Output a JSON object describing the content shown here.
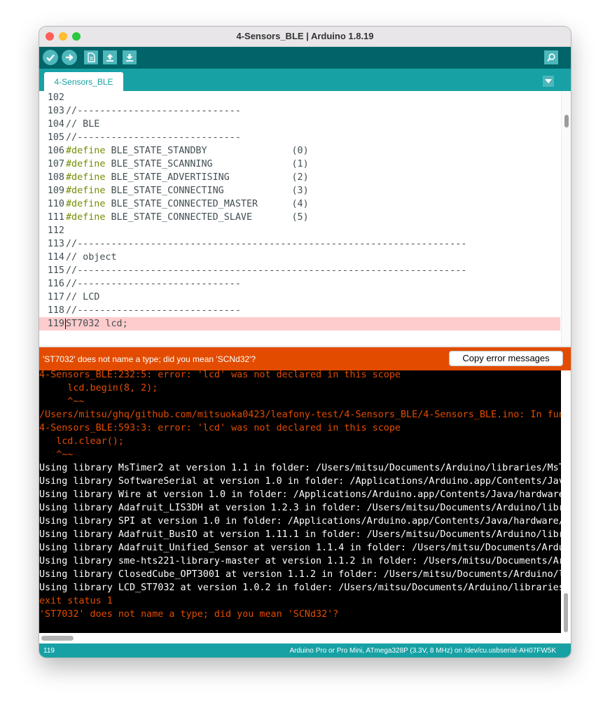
{
  "window": {
    "title": "4-Sensors_BLE | Arduino 1.8.19"
  },
  "toolbar": {
    "buttons": [
      "verify-icon",
      "upload-icon",
      "new-icon",
      "open-icon",
      "save-icon"
    ],
    "serial_monitor": "magnifier-icon"
  },
  "tabs": [
    {
      "label": "4-Sensors_BLE"
    }
  ],
  "editor": {
    "lines": [
      {
        "num": "102",
        "kw": "",
        "text": ""
      },
      {
        "num": "103",
        "kw": "",
        "text": "//-----------------------------"
      },
      {
        "num": "104",
        "kw": "",
        "text": "// BLE"
      },
      {
        "num": "105",
        "kw": "",
        "text": "//-----------------------------"
      },
      {
        "num": "106",
        "kw": "#define",
        "text": " BLE_STATE_STANDBY               (0)"
      },
      {
        "num": "107",
        "kw": "#define",
        "text": " BLE_STATE_SCANNING              (1)"
      },
      {
        "num": "108",
        "kw": "#define",
        "text": " BLE_STATE_ADVERTISING           (2)"
      },
      {
        "num": "109",
        "kw": "#define",
        "text": " BLE_STATE_CONNECTING            (3)"
      },
      {
        "num": "110",
        "kw": "#define",
        "text": " BLE_STATE_CONNECTED_MASTER      (4)"
      },
      {
        "num": "111",
        "kw": "#define",
        "text": " BLE_STATE_CONNECTED_SLAVE       (5)"
      },
      {
        "num": "112",
        "kw": "",
        "text": ""
      },
      {
        "num": "113",
        "kw": "",
        "text": "//---------------------------------------------------------------------"
      },
      {
        "num": "114",
        "kw": "",
        "text": "// object"
      },
      {
        "num": "115",
        "kw": "",
        "text": "//---------------------------------------------------------------------"
      },
      {
        "num": "116",
        "kw": "",
        "text": "//-----------------------------"
      },
      {
        "num": "117",
        "kw": "",
        "text": "// LCD"
      },
      {
        "num": "118",
        "kw": "",
        "text": "//-----------------------------"
      },
      {
        "num": "119",
        "kw": "",
        "text": "ST7032 lcd;",
        "error": true
      }
    ]
  },
  "error_bar": {
    "message": "'ST7032' does not name a type; did you mean 'SCNd32'?",
    "copy_button": "Copy error messages"
  },
  "console": {
    "lines": [
      {
        "text": "4-Sensors_BLE:232:5: error: 'lcd' was not declared in this scope",
        "red": true
      },
      {
        "text": "     lcd.begin(8, 2);",
        "red": true
      },
      {
        "text": "     ^~~",
        "red": true
      },
      {
        "text": "/Users/mitsu/ghq/github.com/mitsuoka0423/leafony-test/4-Sensors_BLE/4-Sensors_BLE.ino: In fun",
        "red": true
      },
      {
        "text": "4-Sensors_BLE:593:3: error: 'lcd' was not declared in this scope",
        "red": true
      },
      {
        "text": "   lcd.clear();",
        "red": true
      },
      {
        "text": "   ^~~",
        "red": true
      },
      {
        "text": "Using library MsTimer2 at version 1.1 in folder: /Users/mitsu/Documents/Arduino/libraries/MsT",
        "red": false
      },
      {
        "text": "Using library SoftwareSerial at version 1.0 in folder: /Applications/Arduino.app/Contents/Jav",
        "red": false
      },
      {
        "text": "Using library Wire at version 1.0 in folder: /Applications/Arduino.app/Contents/Java/hardware",
        "red": false
      },
      {
        "text": "Using library Adafruit_LIS3DH at version 1.2.3 in folder: /Users/mitsu/Documents/Arduino/libr",
        "red": false
      },
      {
        "text": "Using library SPI at version 1.0 in folder: /Applications/Arduino.app/Contents/Java/hardware/",
        "red": false
      },
      {
        "text": "Using library Adafruit_BusIO at version 1.11.1 in folder: /Users/mitsu/Documents/Arduino/libr",
        "red": false
      },
      {
        "text": "Using library Adafruit_Unified_Sensor at version 1.1.4 in folder: /Users/mitsu/Documents/Ardu",
        "red": false
      },
      {
        "text": "Using library sme-hts221-library-master at version 1.1.2 in folder: /Users/mitsu/Documents/Ar",
        "red": false
      },
      {
        "text": "Using library ClosedCube_OPT3001 at version 1.1.2 in folder: /Users/mitsu/Documents/Arduino/l",
        "red": false
      },
      {
        "text": "Using library LCD_ST7032 at version 1.0.2 in folder: /Users/mitsu/Documents/Arduino/libraries",
        "red": false
      },
      {
        "text": "exit status 1",
        "red": true
      },
      {
        "text": "'ST7032' does not name a type; did you mean 'SCNd32'?",
        "red": true
      }
    ]
  },
  "status": {
    "line": "119",
    "board": "Arduino Pro or Pro Mini, ATmega328P (3.3V, 8 MHz) on /dev/cu.usbserial-AH07FW5K"
  },
  "colors": {
    "teal_dark": "#006468",
    "teal": "#17a1a5",
    "teal_light": "#4db7bb",
    "error": "#e34c00",
    "error_line": "#ffcccd",
    "keyword": "#728e00"
  }
}
